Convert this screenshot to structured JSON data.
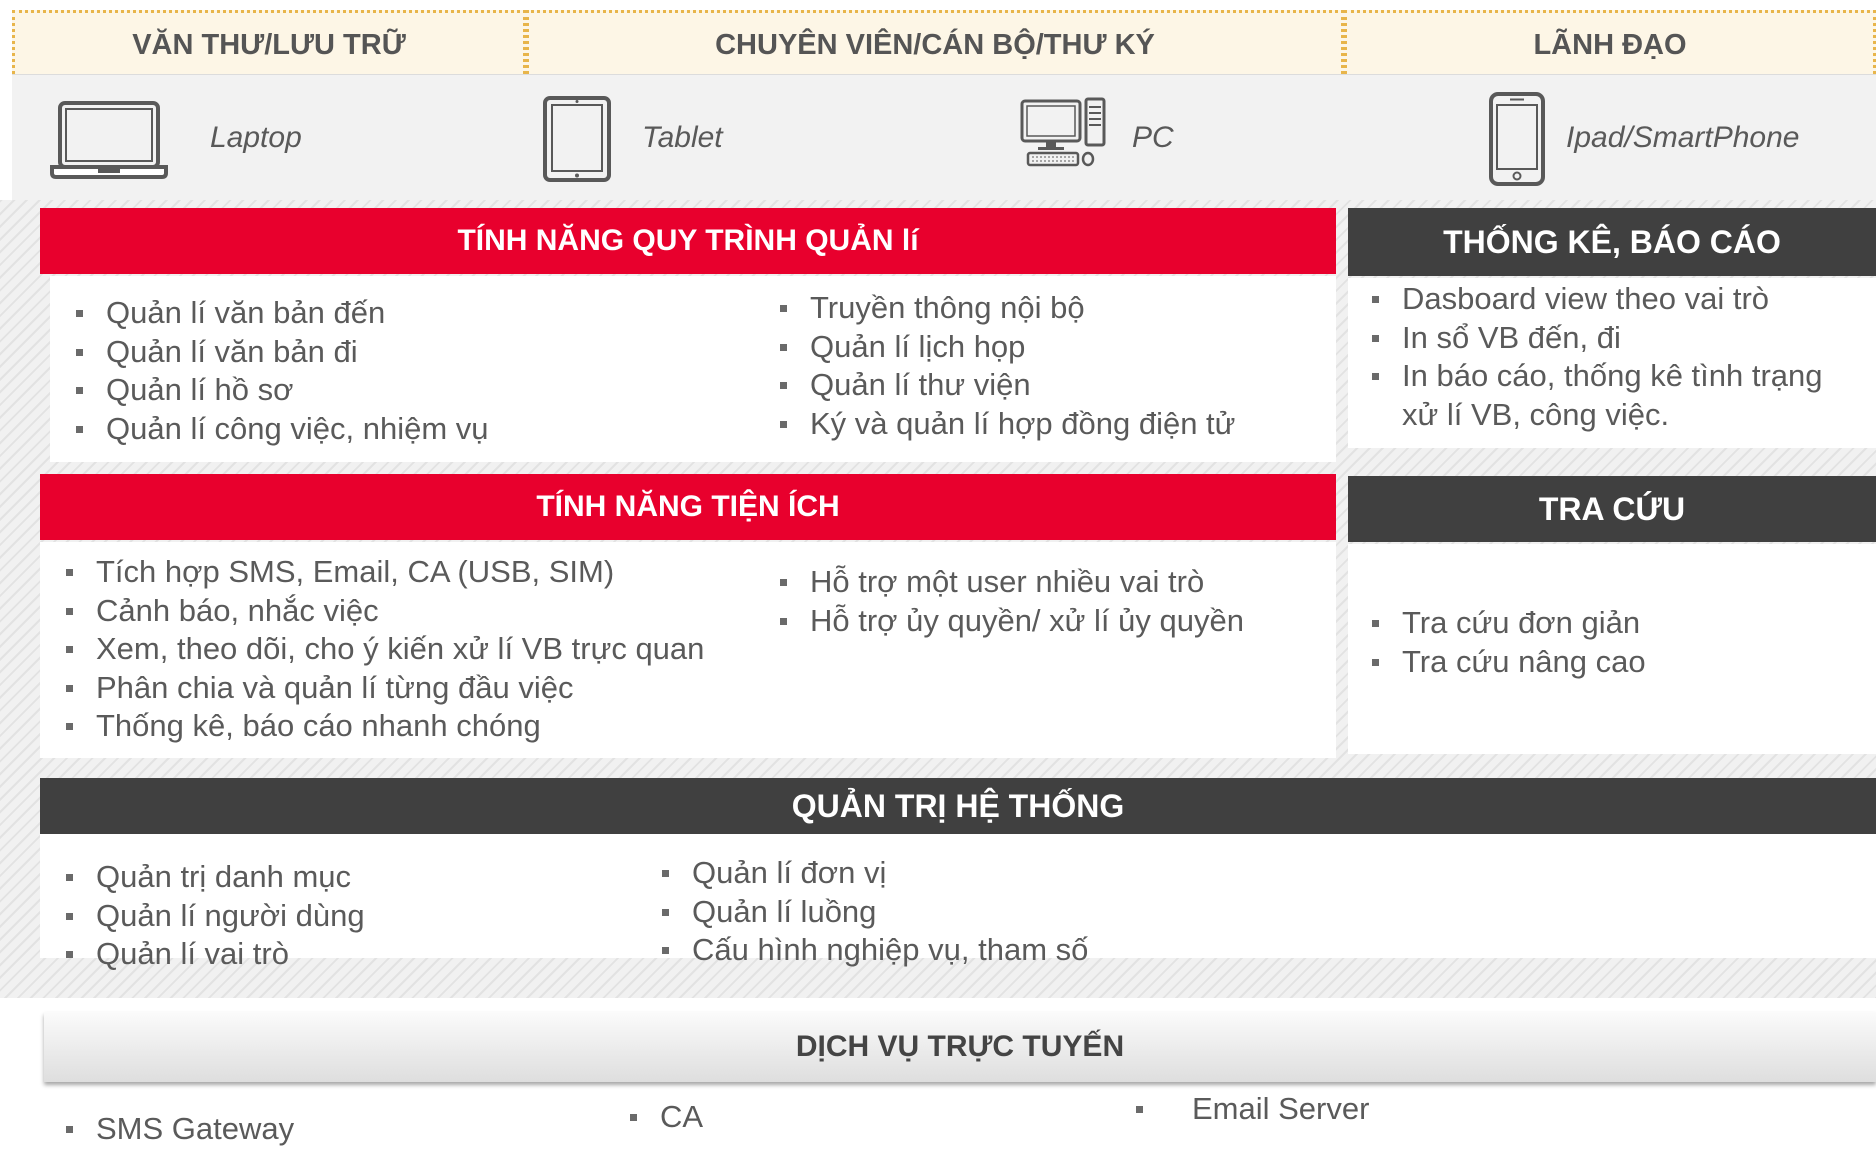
{
  "roles": [
    "VĂN THƯ/LƯU TRỮ",
    "CHUYÊN VIÊN/CÁN BỘ/THƯ KÝ",
    "LÃNH ĐẠO"
  ],
  "devices": [
    {
      "label": "Laptop",
      "icon": "laptop-icon"
    },
    {
      "label": "Tablet",
      "icon": "tablet-icon"
    },
    {
      "label": "PC",
      "icon": "desktop-pc-icon"
    },
    {
      "label": "Ipad/SmartPhone",
      "icon": "smartphone-icon"
    }
  ],
  "process": {
    "title": "TÍNH NĂNG QUY TRÌNH QUẢN lí",
    "left": [
      "Quản lí văn bản đến",
      "Quản lí văn bản đi",
      "Quản lí hồ sơ",
      "Quản lí công việc, nhiệm vụ"
    ],
    "right": [
      "Truyền thông nội bộ",
      "Quản lí lịch họp",
      "Quản lí thư viện",
      "Ký và quản lí hợp đồng điện tử"
    ]
  },
  "stats": {
    "title": "THỐNG KÊ, BÁO CÁO",
    "items": [
      "Dasboard  view theo vai trò",
      "In sổ VB đến, đi",
      "In báo cáo, thống kê tình trạng",
      "xử lí VB, công việc."
    ]
  },
  "utility": {
    "title": "TÍNH NĂNG TIỆN ÍCH",
    "left": [
      "Tích hợp SMS, Email, CA (USB, SIM)",
      "Cảnh báo, nhắc việc",
      "Xem, theo dõi, cho ý kiến xử lí VB trực quan",
      "Phân chia và quản lí từng đầu việc",
      "Thống kê, báo cáo nhanh chóng"
    ],
    "right": [
      "Hỗ trợ một user nhiều vai trò",
      "Hỗ trợ ủy quyền/ xử lí ủy quyền"
    ]
  },
  "search": {
    "title": "TRA CỨU",
    "items": [
      "Tra cứu đơn giản",
      "Tra cứu nâng cao"
    ]
  },
  "admin": {
    "title": "QUẢN TRỊ HỆ THỐNG",
    "left": [
      "Quản trị danh mục",
      "Quản lí người dùng",
      "Quản lí vai trò"
    ],
    "right": [
      "Quản lí đơn vị",
      "Quản lí luồng",
      "Cấu hình nghiệp vụ, tham số"
    ]
  },
  "services": {
    "title": "DỊCH VỤ TRỰC TUYẾN",
    "items": [
      "SMS Gateway",
      "CA",
      "Email Server"
    ]
  },
  "colors": {
    "accent_red": "#e8002d",
    "dark_header": "#404040",
    "role_border": "#e8b54a"
  }
}
